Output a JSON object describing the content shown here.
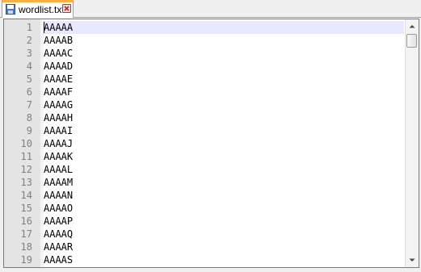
{
  "tab": {
    "filename": "wordlist.txt",
    "icon": "save-disk-icon",
    "close_icon": "close-icon",
    "accent_color": "#f6b043"
  },
  "editor": {
    "current_line": 1,
    "lines": [
      {
        "number": "1",
        "text": "AAAAA"
      },
      {
        "number": "2",
        "text": "AAAAB"
      },
      {
        "number": "3",
        "text": "AAAAC"
      },
      {
        "number": "4",
        "text": "AAAAD"
      },
      {
        "number": "5",
        "text": "AAAAE"
      },
      {
        "number": "6",
        "text": "AAAAF"
      },
      {
        "number": "7",
        "text": "AAAAG"
      },
      {
        "number": "8",
        "text": "AAAAH"
      },
      {
        "number": "9",
        "text": "AAAAI"
      },
      {
        "number": "10",
        "text": "AAAAJ"
      },
      {
        "number": "11",
        "text": "AAAAK"
      },
      {
        "number": "12",
        "text": "AAAAL"
      },
      {
        "number": "13",
        "text": "AAAAM"
      },
      {
        "number": "14",
        "text": "AAAAN"
      },
      {
        "number": "15",
        "text": "AAAAO"
      },
      {
        "number": "16",
        "text": "AAAAP"
      },
      {
        "number": "17",
        "text": "AAAAQ"
      },
      {
        "number": "18",
        "text": "AAAAR"
      },
      {
        "number": "19",
        "text": "AAAAS"
      }
    ]
  }
}
